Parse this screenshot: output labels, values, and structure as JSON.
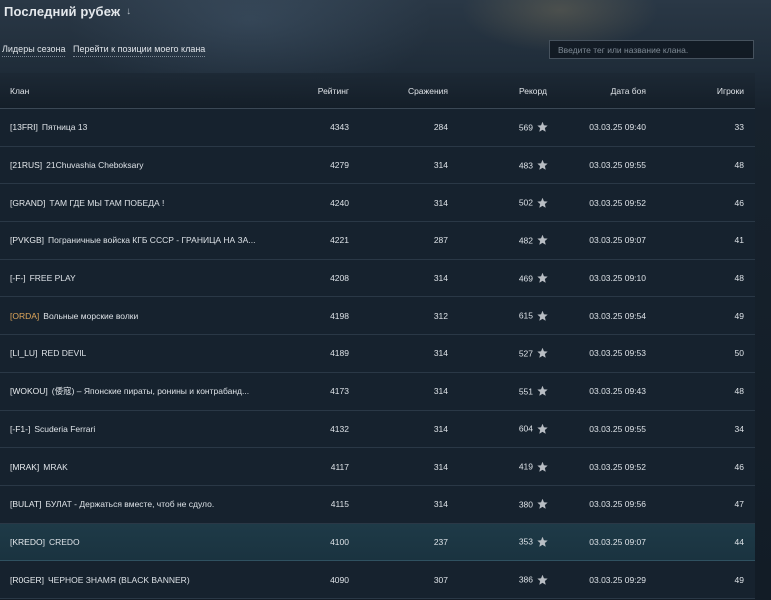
{
  "header": {
    "title": "Последний рубеж",
    "title_arrow": "↓"
  },
  "toolbar": {
    "leaders_link": "Лидеры сезона",
    "goto_link": "Перейти к позиции моего клана",
    "search_placeholder": "Введите тег или название клана."
  },
  "table": {
    "columns": {
      "clan": "Клан",
      "rating": "Рейтинг",
      "battles": "Сражения",
      "record": "Рекорд",
      "date": "Дата боя",
      "players": "Игроки"
    },
    "rows": [
      {
        "tag": "[13FRI]",
        "name": "Пятница 13",
        "rating": "4343",
        "battles": "284",
        "record": "569",
        "date": "03.03.25 09:40",
        "players": "33",
        "tag_color": "#e8ecef",
        "highlight": false
      },
      {
        "tag": "[21RUS]",
        "name": "21Chuvashia Cheboksary",
        "rating": "4279",
        "battles": "314",
        "record": "483",
        "date": "03.03.25 09:55",
        "players": "48",
        "tag_color": "#e8ecef",
        "highlight": false
      },
      {
        "tag": "[GRAND]",
        "name": "ТАМ ГДЕ МЫ ТАМ ПОБЕДА !",
        "rating": "4240",
        "battles": "314",
        "record": "502",
        "date": "03.03.25 09:52",
        "players": "46",
        "tag_color": "#e8ecef",
        "highlight": false
      },
      {
        "tag": "[PVKGB]",
        "name": "Пограничные войска КГБ СССР - ГРАНИЦА НА ЗА...",
        "rating": "4221",
        "battles": "287",
        "record": "482",
        "date": "03.03.25 09:07",
        "players": "41",
        "tag_color": "#e8ecef",
        "highlight": false
      },
      {
        "tag": "[-F-]",
        "name": "FREE PLAY",
        "rating": "4208",
        "battles": "314",
        "record": "469",
        "date": "03.03.25 09:10",
        "players": "48",
        "tag_color": "#e8ecef",
        "highlight": false
      },
      {
        "tag": "[ORDA]",
        "name": "Вольные морские волки",
        "rating": "4198",
        "battles": "312",
        "record": "615",
        "date": "03.03.25 09:54",
        "players": "49",
        "tag_color": "#e0a75a",
        "highlight": false
      },
      {
        "tag": "[LI_LU]",
        "name": "RED DEVIL",
        "rating": "4189",
        "battles": "314",
        "record": "527",
        "date": "03.03.25 09:53",
        "players": "50",
        "tag_color": "#e8ecef",
        "highlight": false
      },
      {
        "tag": "[WOKOU]",
        "name": "(倭寇) – Японские пираты, ронины и контрабанд...",
        "rating": "4173",
        "battles": "314",
        "record": "551",
        "date": "03.03.25 09:43",
        "players": "48",
        "tag_color": "#e8ecef",
        "highlight": false
      },
      {
        "tag": "[-F1-]",
        "name": "Scuderia Ferrari",
        "rating": "4132",
        "battles": "314",
        "record": "604",
        "date": "03.03.25 09:55",
        "players": "34",
        "tag_color": "#e8ecef",
        "highlight": false
      },
      {
        "tag": "[MRAK]",
        "name": "MRAK",
        "rating": "4117",
        "battles": "314",
        "record": "419",
        "date": "03.03.25 09:52",
        "players": "46",
        "tag_color": "#e8ecef",
        "highlight": false
      },
      {
        "tag": "[BULAT]",
        "name": "БУЛАТ - Держаться вместе, чтоб не сдуло.",
        "rating": "4115",
        "battles": "314",
        "record": "380",
        "date": "03.03.25 09:56",
        "players": "47",
        "tag_color": "#e8ecef",
        "highlight": false
      },
      {
        "tag": "[KREDO]",
        "name": "CREDO",
        "rating": "4100",
        "battles": "237",
        "record": "353",
        "date": "03.03.25 09:07",
        "players": "44",
        "tag_color": "#e8ecef",
        "highlight": true
      },
      {
        "tag": "[R0GER]",
        "name": "ЧЕРНОЕ ЗНАМЯ (BLACK BANNER)",
        "rating": "4090",
        "battles": "307",
        "record": "386",
        "date": "03.03.25 09:29",
        "players": "49",
        "tag_color": "#e8ecef",
        "highlight": false
      }
    ]
  },
  "icons": {
    "record_star": "star-icon",
    "title_arrow": "arrow-down-icon"
  }
}
